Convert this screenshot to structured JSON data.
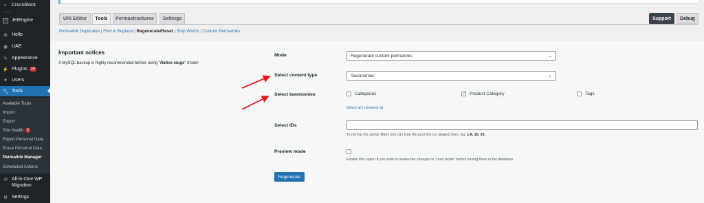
{
  "sidebar": {
    "items": [
      {
        "label": "Crocoblock",
        "icon": "crocoblock-icon"
      },
      {
        "label": "JetEngine",
        "icon": "jetengine-icon"
      },
      {
        "label": "Hello",
        "icon": "hello-icon"
      },
      {
        "label": "UAE",
        "icon": "uae-icon"
      },
      {
        "label": "Appearance",
        "icon": "paintbrush-icon"
      },
      {
        "label": "Plugins",
        "icon": "plugin-icon",
        "badge": "14"
      },
      {
        "label": "Users",
        "icon": "user-icon"
      },
      {
        "label": "Tools",
        "icon": "wrench-icon"
      }
    ],
    "submenu": [
      {
        "label": "Available Tools"
      },
      {
        "label": "Import"
      },
      {
        "label": "Export"
      },
      {
        "label": "Site Health",
        "badge": "2"
      },
      {
        "label": "Export Personal Data"
      },
      {
        "label": "Erase Personal Data"
      },
      {
        "label": "Permalink Manager"
      },
      {
        "label": "Scheduled Actions"
      }
    ],
    "bottom": [
      {
        "label_line1": "All-in-One WP",
        "label_line2": "Migration",
        "icon": "migration-icon"
      },
      {
        "label": "Settings",
        "icon": "settings-icon"
      }
    ]
  },
  "tabs": [
    {
      "label": "URI Editor"
    },
    {
      "label": "Tools"
    },
    {
      "label": "Permastructures"
    },
    {
      "label": "Settings"
    }
  ],
  "right_buttons": {
    "support": "Support",
    "debug": "Debug"
  },
  "subnav": {
    "items": [
      "Permalink Duplicates",
      "Find & Replace",
      "Regenerate/Reset",
      "Stop Words",
      "Custom Permalinks"
    ],
    "separator": "|"
  },
  "notice": {
    "title": "Important notices",
    "text_before": "A MySQL backup is highly recommended before using \"",
    "text_em": "Native slugs",
    "text_after": "\" mode!"
  },
  "form": {
    "mode_label": "Mode",
    "mode_value": "Regenerate custom permalinks",
    "content_type_label": "Select content type",
    "content_type_value": "Taxonomies",
    "taxonomies_label": "Select taxonomies",
    "taxonomies": [
      {
        "label": "Categories",
        "checked": false
      },
      {
        "label": "Product Category",
        "checked": true
      },
      {
        "label": "Tags",
        "checked": false
      }
    ],
    "select_all": "Select all",
    "unselect_all": "Unselect all",
    "select_sep": "|",
    "ids_label": "Select IDs",
    "ids_value": "",
    "ids_help_before": "To narrow the above filters you can type the post IDs (or ranges) here. Eg. ",
    "ids_help_example": "1-8, 10, 20.",
    "preview_label": "Preview mode",
    "preview_help": "Enable this option if you want to review the changes in \"read mode\" before saving them in the database.",
    "submit": "Regenerate"
  },
  "colors": {
    "accent": "#2271b1",
    "sidebar_bg": "#1d2327",
    "arrow": "#e8141c"
  }
}
